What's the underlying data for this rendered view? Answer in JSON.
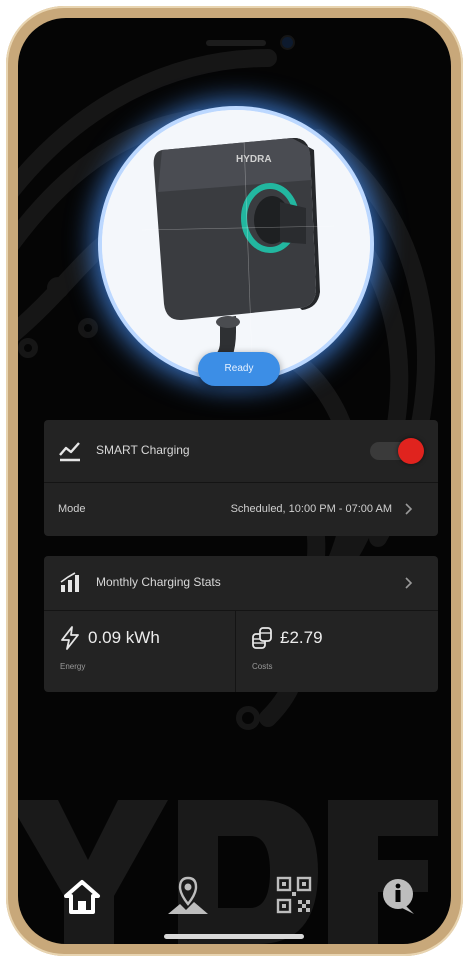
{
  "status": {
    "ready_label": "Ready"
  },
  "charger": {
    "brand_text": "HYDRA",
    "image": "charger-device-image"
  },
  "smart_charging": {
    "title": "SMART Charging",
    "icon": "trend-chart-icon",
    "toggle_on": true,
    "toggle_color": "#e0231e",
    "mode_label": "Mode",
    "mode_value": "Scheduled, 10:00 PM - 07:00 AM"
  },
  "monthly_stats": {
    "title": "Monthly Charging Stats",
    "icon": "bar-chart-icon",
    "energy": {
      "value": "0.09 kWh",
      "label": "Energy",
      "icon": "lightning-icon"
    },
    "costs": {
      "value": "£2.79",
      "label": "Costs",
      "icon": "coins-icon"
    }
  },
  "nav": {
    "items": [
      {
        "name": "home",
        "icon": "home-icon",
        "active": true
      },
      {
        "name": "map",
        "icon": "map-pin-icon",
        "active": false
      },
      {
        "name": "scan",
        "icon": "qr-code-icon",
        "active": false
      },
      {
        "name": "info",
        "icon": "info-icon",
        "active": false
      }
    ]
  },
  "colors": {
    "accent_blue": "#3c8ee6",
    "glow_blue": "#4a96ff",
    "card_bg": "#232323",
    "screen_bg": "#050505",
    "frame_gold": "#c8a87a",
    "toggle_red": "#e0231e"
  }
}
